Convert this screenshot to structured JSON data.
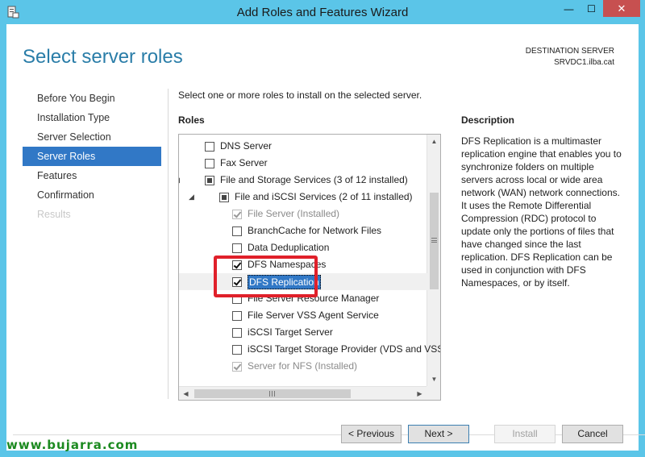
{
  "window": {
    "title": "Add Roles and Features Wizard",
    "min_glyph": "—",
    "max_glyph": "☐",
    "close_glyph": "✕"
  },
  "header": {
    "page_title": "Select server roles",
    "dest_label": "DESTINATION SERVER",
    "dest_server": "SRVDC1.ilba.cat"
  },
  "nav": {
    "items": [
      {
        "label": "Before You Begin",
        "state": "normal"
      },
      {
        "label": "Installation Type",
        "state": "normal"
      },
      {
        "label": "Server Selection",
        "state": "normal"
      },
      {
        "label": "Server Roles",
        "state": "active"
      },
      {
        "label": "Features",
        "state": "normal"
      },
      {
        "label": "Confirmation",
        "state": "normal"
      },
      {
        "label": "Results",
        "state": "disabled"
      }
    ]
  },
  "main": {
    "instruction": "Select one or more roles to install on the selected server.",
    "roles_heading": "Roles",
    "description_heading": "Description",
    "description_text": "DFS Replication is a multimaster replication engine that enables you to synchronize folders on multiple servers across local or wide area network (WAN) network connections. It uses the Remote Differential Compression (RDC) protocol to update only the portions of files that have changed since the last replication. DFS Replication can be used in conjunction with DFS Namespaces, or by itself."
  },
  "roles": [
    {
      "label": "DNS Server",
      "level": 0,
      "check": "unchecked",
      "expander": ""
    },
    {
      "label": "Fax Server",
      "level": 0,
      "check": "unchecked",
      "expander": ""
    },
    {
      "label": "File and Storage Services (3 of 12 installed)",
      "level": 0,
      "check": "partial",
      "expander": "◢"
    },
    {
      "label": "File and iSCSI Services (2 of 11 installed)",
      "level": 1,
      "check": "partial",
      "expander": "◢"
    },
    {
      "label": "File Server (Installed)",
      "level": 2,
      "check": "checked-disabled",
      "expander": ""
    },
    {
      "label": "BranchCache for Network Files",
      "level": 2,
      "check": "unchecked",
      "expander": ""
    },
    {
      "label": "Data Deduplication",
      "level": 2,
      "check": "unchecked",
      "expander": ""
    },
    {
      "label": "DFS Namespaces",
      "level": 2,
      "check": "checked",
      "expander": ""
    },
    {
      "label": "DFS Replication",
      "level": 2,
      "check": "checked",
      "expander": "",
      "selected": true
    },
    {
      "label": "File Server Resource Manager",
      "level": 2,
      "check": "unchecked",
      "expander": ""
    },
    {
      "label": "File Server VSS Agent Service",
      "level": 2,
      "check": "unchecked",
      "expander": ""
    },
    {
      "label": "iSCSI Target Server",
      "level": 2,
      "check": "unchecked",
      "expander": ""
    },
    {
      "label": "iSCSI Target Storage Provider (VDS and VSS",
      "level": 2,
      "check": "unchecked",
      "expander": ""
    },
    {
      "label": "Server for NFS (Installed)",
      "level": 2,
      "check": "checked-disabled",
      "expander": ""
    }
  ],
  "scroll": {
    "up": "▲",
    "down": "▼",
    "left": "◀",
    "right": "▶"
  },
  "buttons": {
    "previous": "< Previous",
    "next": "Next >",
    "install": "Install",
    "cancel": "Cancel"
  },
  "watermark": "www.bujarra.com"
}
